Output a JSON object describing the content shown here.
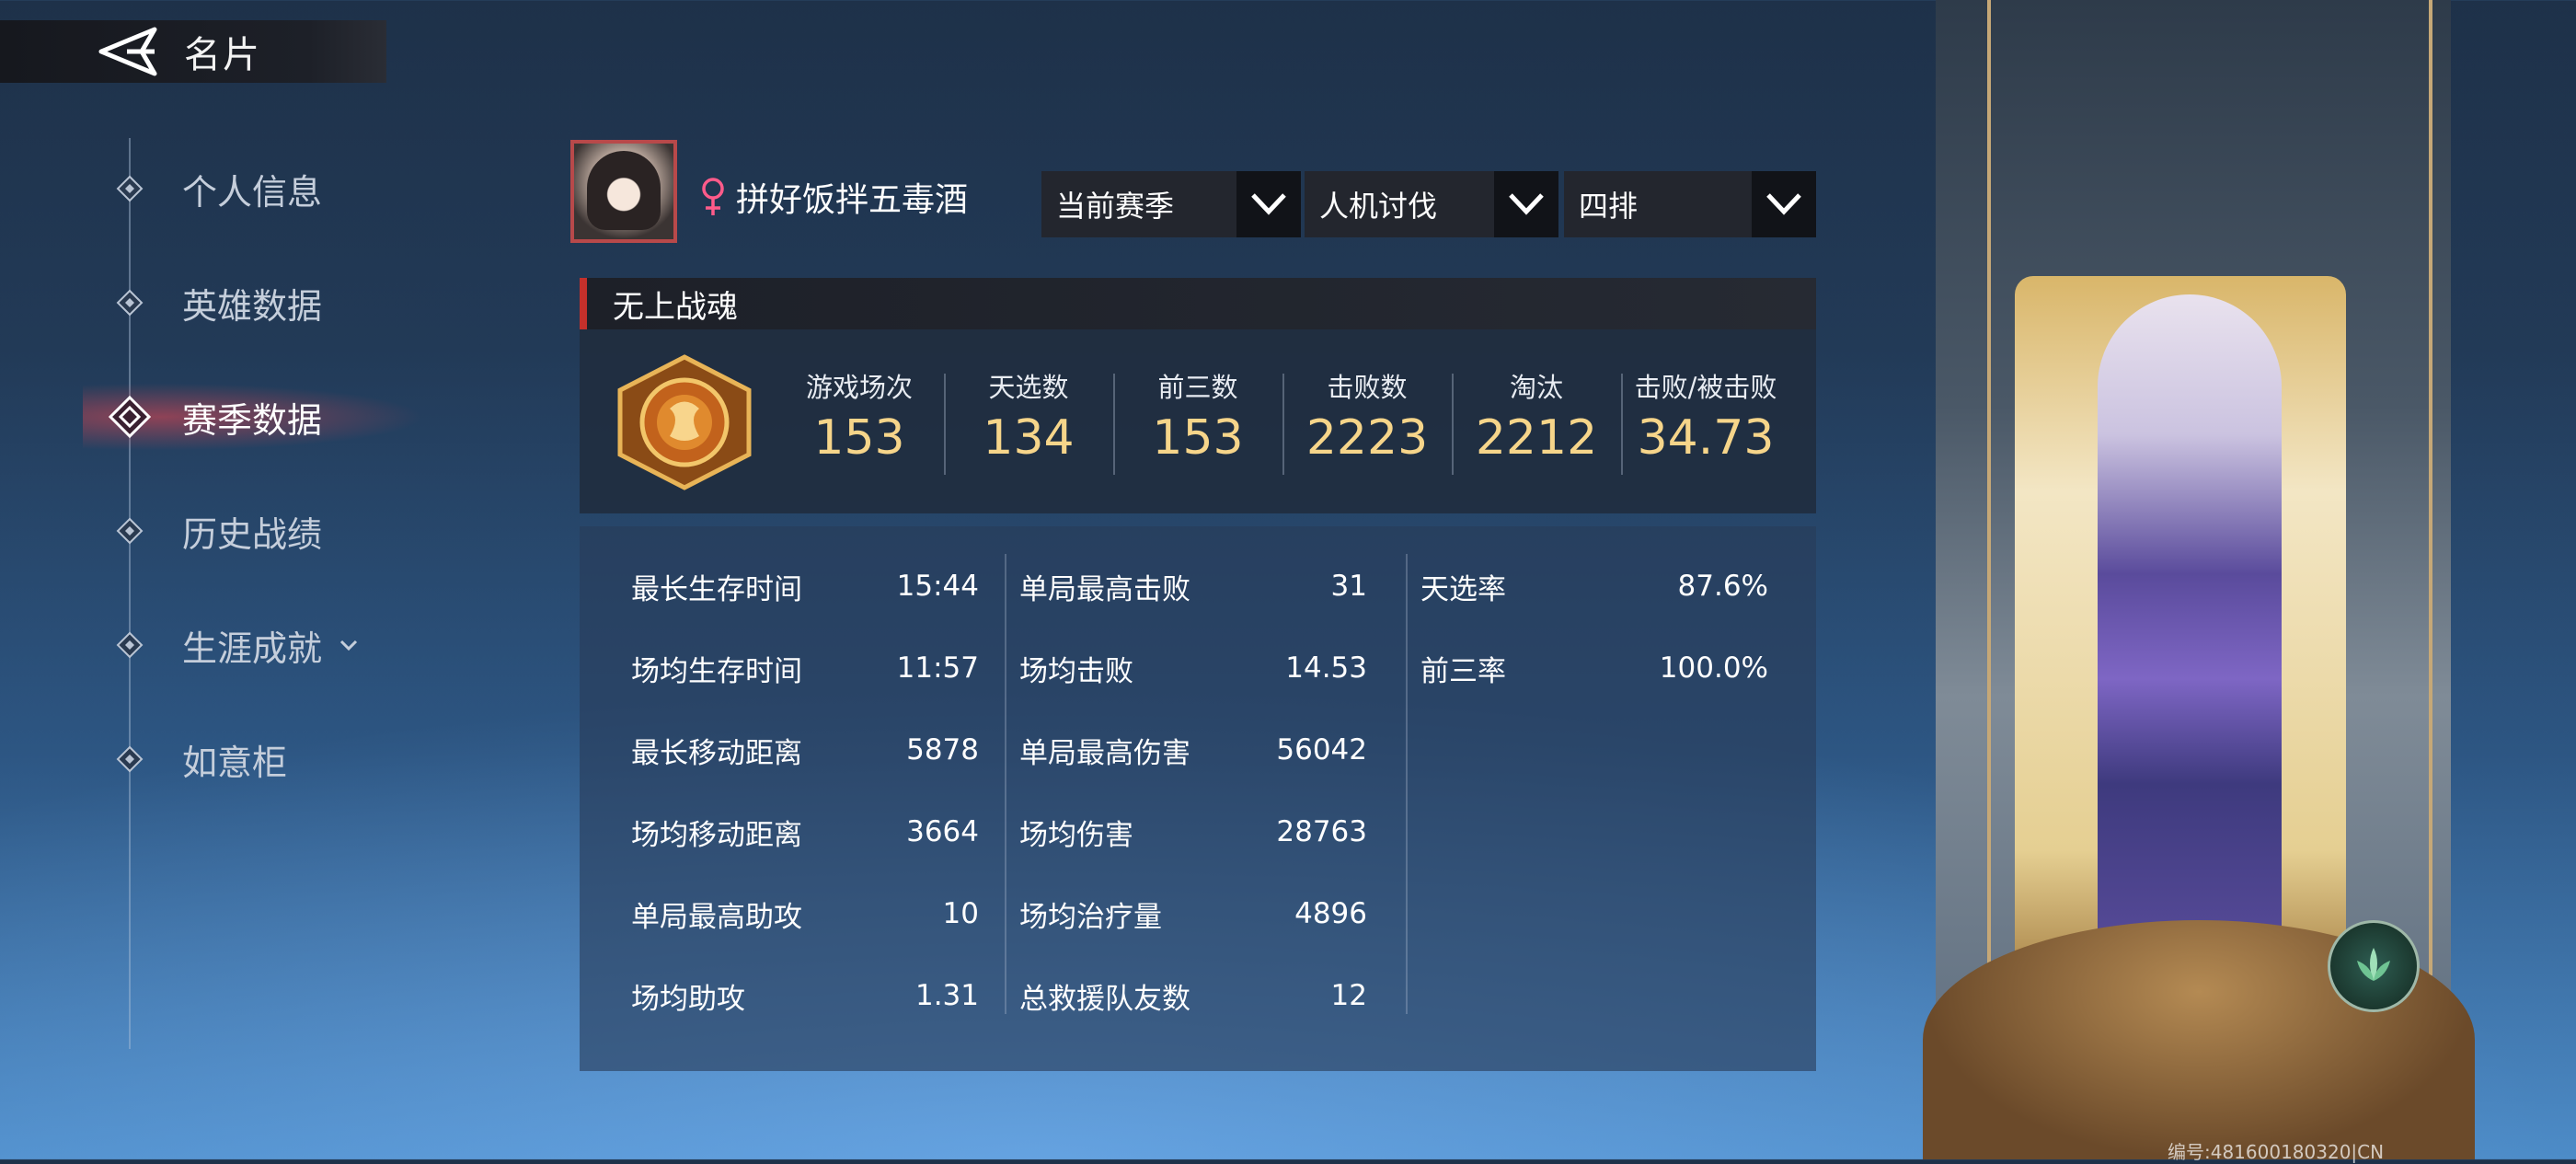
{
  "header": {
    "title": "名片"
  },
  "sidebar": {
    "items": [
      {
        "label": "个人信息",
        "active": false
      },
      {
        "label": "英雄数据",
        "active": false
      },
      {
        "label": "赛季数据",
        "active": true
      },
      {
        "label": "历史战绩",
        "active": false
      },
      {
        "label": "生涯成就",
        "active": false,
        "expandable": true
      },
      {
        "label": "如意柜",
        "active": false
      }
    ]
  },
  "profile": {
    "name": "拼好饭拌五毒酒",
    "gender_icon": "female-icon"
  },
  "filters": [
    {
      "value": "当前赛季"
    },
    {
      "value": "人机讨伐"
    },
    {
      "value": "四排"
    }
  ],
  "rank": {
    "title": "无上战魂"
  },
  "summary": [
    {
      "label": "游戏场次",
      "value": "153"
    },
    {
      "label": "天选数",
      "value": "134"
    },
    {
      "label": "前三数",
      "value": "153"
    },
    {
      "label": "击败数",
      "value": "2223"
    },
    {
      "label": "淘汰",
      "value": "2212"
    },
    {
      "label": "击败/被击败",
      "value": "34.73"
    }
  ],
  "details": {
    "col1": [
      {
        "label": "最长生存时间",
        "value": "15:44"
      },
      {
        "label": "场均生存时间",
        "value": "11:57"
      },
      {
        "label": "最长移动距离",
        "value": "5878"
      },
      {
        "label": "场均移动距离",
        "value": "3664"
      },
      {
        "label": "单局最高助攻",
        "value": "10"
      },
      {
        "label": "场均助攻",
        "value": "1.31"
      }
    ],
    "col2": [
      {
        "label": "单局最高击败",
        "value": "31"
      },
      {
        "label": "场均击败",
        "value": "14.53"
      },
      {
        "label": "单局最高伤害",
        "value": "56042"
      },
      {
        "label": "场均伤害",
        "value": "28763"
      },
      {
        "label": "场均治疗量",
        "value": "4896"
      },
      {
        "label": "总救援队友数",
        "value": "12"
      }
    ],
    "col3": [
      {
        "label": "天选率",
        "value": "87.6%"
      },
      {
        "label": "前三率",
        "value": "100.0%"
      }
    ]
  },
  "serial": "编号:481600180320|CN",
  "colors": {
    "accent": "#c4302b",
    "stat_value": "#f6d58a"
  }
}
